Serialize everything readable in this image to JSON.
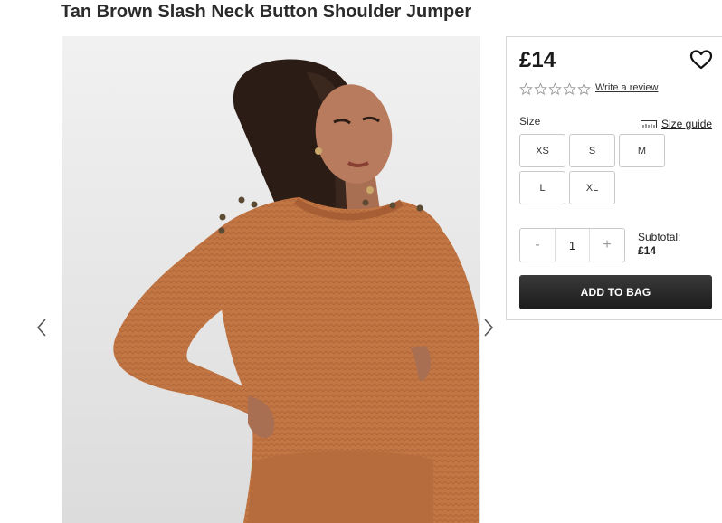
{
  "product": {
    "title": "Tan Brown Slash Neck Button Shoulder Jumper",
    "image_icon": "model-wearing-jumper-photo",
    "price": "£14",
    "wishlist_icon": "heart-outline-icon",
    "rating": {
      "filled": 0,
      "max": 5,
      "star_icon": "star-outline-icon"
    },
    "review_link": "Write a review"
  },
  "gallery": {
    "prev_icon": "chevron-left-icon",
    "next_icon": "chevron-right-icon"
  },
  "sizes": {
    "label": "Size",
    "guide_label": "Size guide",
    "guide_icon": "ruler-icon",
    "options": [
      "XS",
      "S",
      "M",
      "L",
      "XL"
    ]
  },
  "quantity": {
    "decrement_label": "-",
    "value": "1",
    "increment_label": "+"
  },
  "subtotal": {
    "label": "Subtotal:",
    "amount": "£14"
  },
  "add_to_bag_label": "ADD TO BAG",
  "colors": {
    "jumper": "#c0733f",
    "button_dark": "#1f1f1f",
    "border": "#c9c9c9"
  }
}
